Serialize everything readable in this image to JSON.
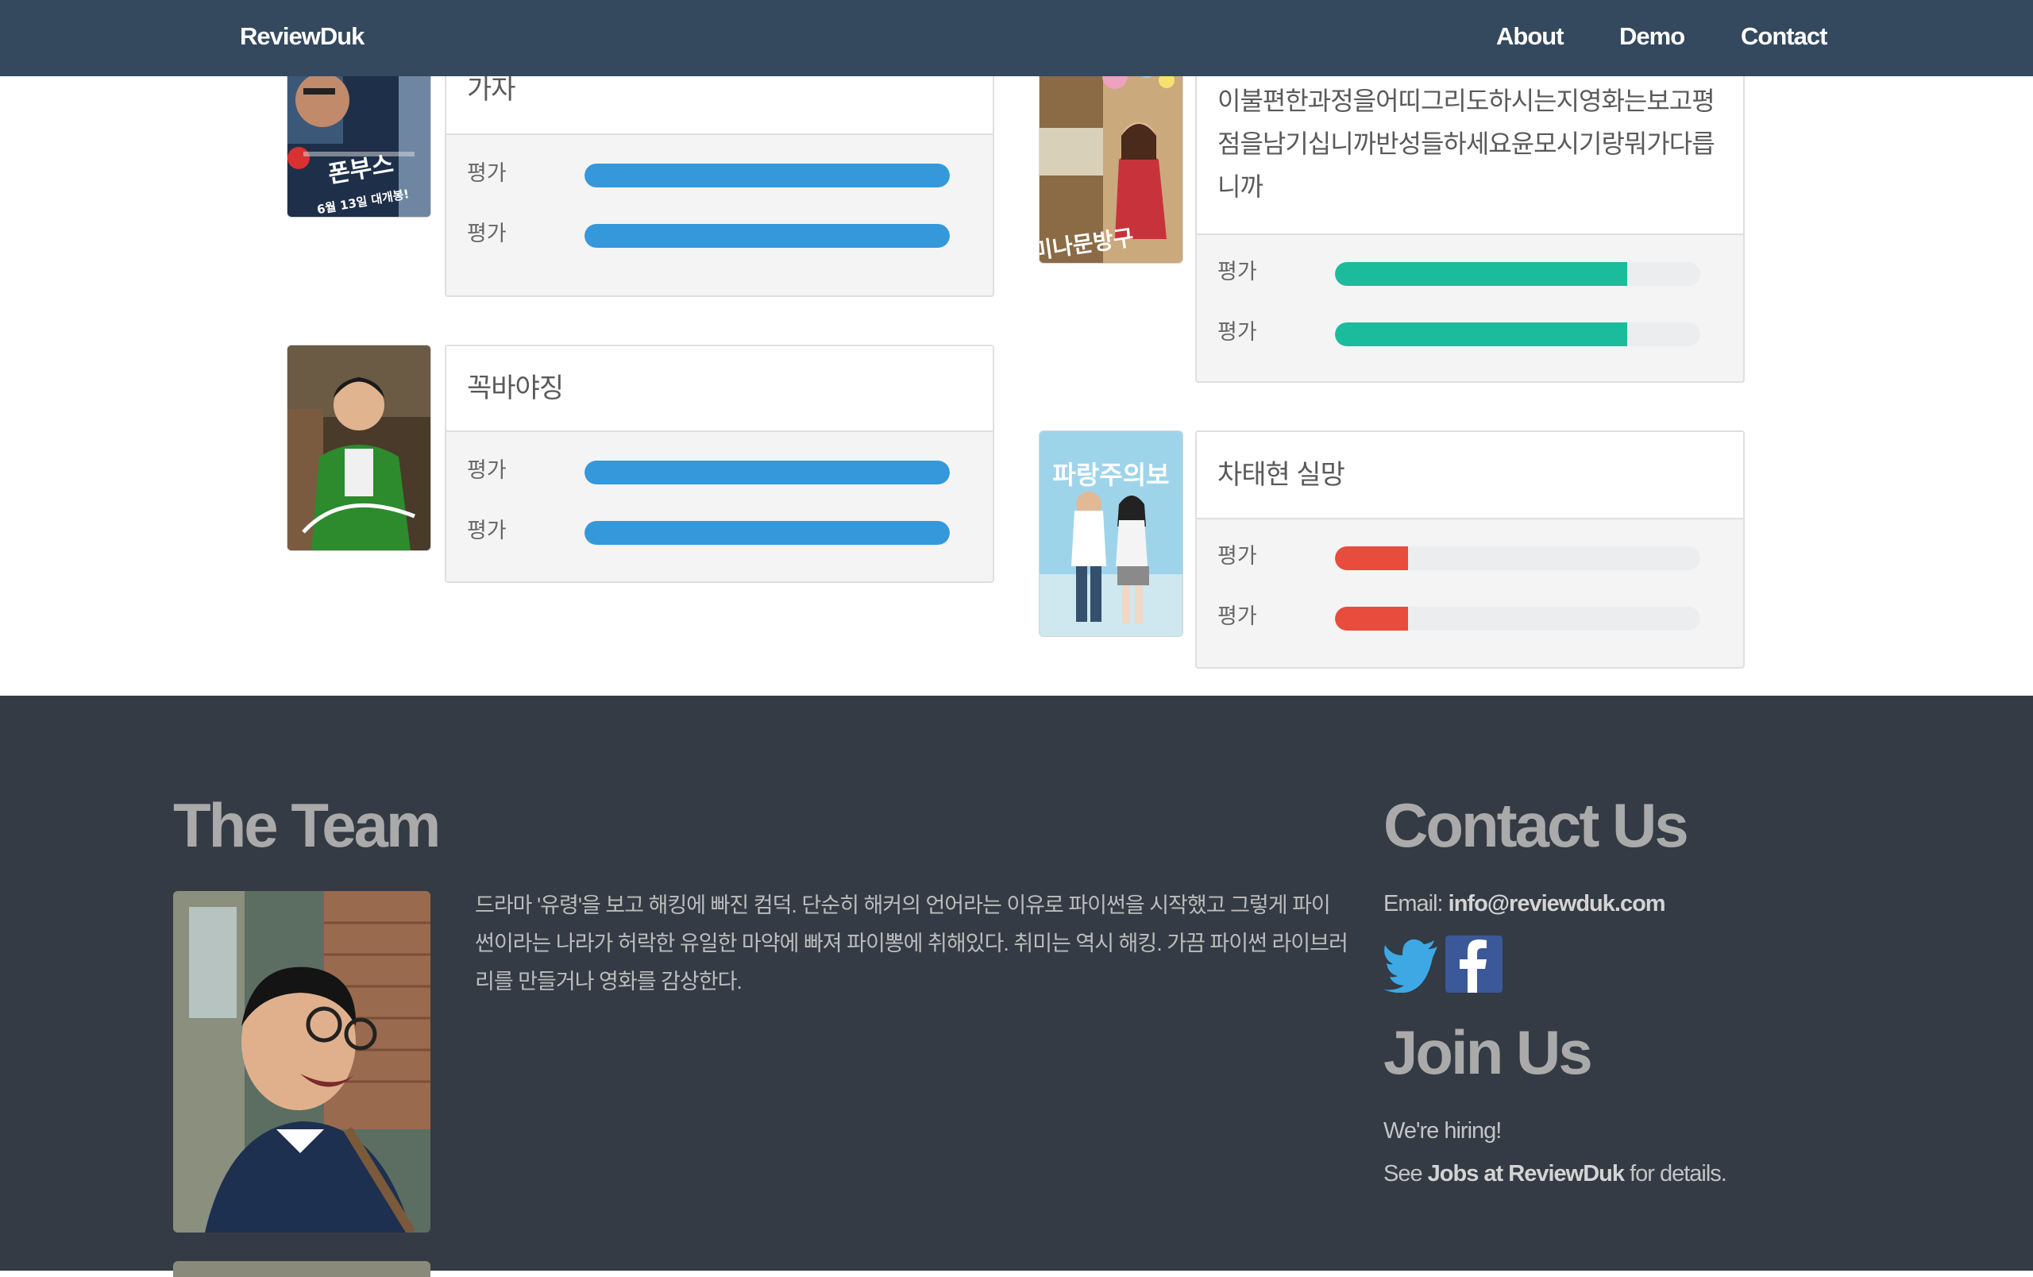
{
  "navbar": {
    "brand": "ReviewDuk",
    "links": [
      "About",
      "Demo",
      "Contact"
    ],
    "background": "#34495e"
  },
  "reviews": [
    {
      "title": "가자",
      "ratings": [
        {
          "label": "평가",
          "value": 1.0
        },
        {
          "label": "평가",
          "value": 1.0
        }
      ],
      "color": "#3498db"
    },
    {
      "title": "꼭바야징",
      "ratings": [
        {
          "label": "평가",
          "value": 1.0
        },
        {
          "label": "평가",
          "value": 1.0
        }
      ],
      "color": "#3498db"
    },
    {
      "title": "이불편한과정을어띠그리도하시는지영화는보고평점을남기십니까반성들하세요윤모시기랑뭐가다릅니까",
      "ratings": [
        {
          "label": "평가",
          "value": 0.8
        },
        {
          "label": "평가",
          "value": 0.8
        }
      ],
      "color": "#1abc9c"
    },
    {
      "title": "차태현 실망",
      "ratings": [
        {
          "label": "평가",
          "value": 0.2
        },
        {
          "label": "평가",
          "value": 0.2
        }
      ],
      "color": "#e74c3c"
    }
  ],
  "posters": [
    {
      "text": "폰부스",
      "subtext": "6월 13일 대개봉!",
      "icon": "movie-poster-phone-booth"
    },
    {
      "text": "",
      "icon": "movie-poster-green-jacket"
    },
    {
      "text": "미나문방구",
      "icon": "movie-poster-mina-stationery"
    },
    {
      "text": "파랑주의보",
      "icon": "movie-poster-blue-alert"
    }
  ],
  "footer": {
    "team": {
      "title": "The Team",
      "bio": "드라마 '유령'을 보고 해킹에 빠진 컴덕. 단순히 해커의 언어라는 이유로 파이썬을 시작했고 그렇게 파이썬이라는 나라가 허락한 유일한 마약에 빠져 파이뽕에 취해있다. 취미는 역시 해킹. 가끔 파이썬 라이브러리를 만들거나 영화를 감상한다."
    },
    "contact": {
      "title": "Contact Us",
      "email_label": "Email:",
      "email": "info@reviewduk.com",
      "social": [
        "twitter-icon",
        "facebook-icon"
      ]
    },
    "join": {
      "title": "Join Us",
      "line1": "We're hiring!",
      "line2_prefix": "See",
      "line2_link": "Jobs at ReviewDuk",
      "line2_suffix": "for details."
    },
    "background": "#343b44"
  }
}
